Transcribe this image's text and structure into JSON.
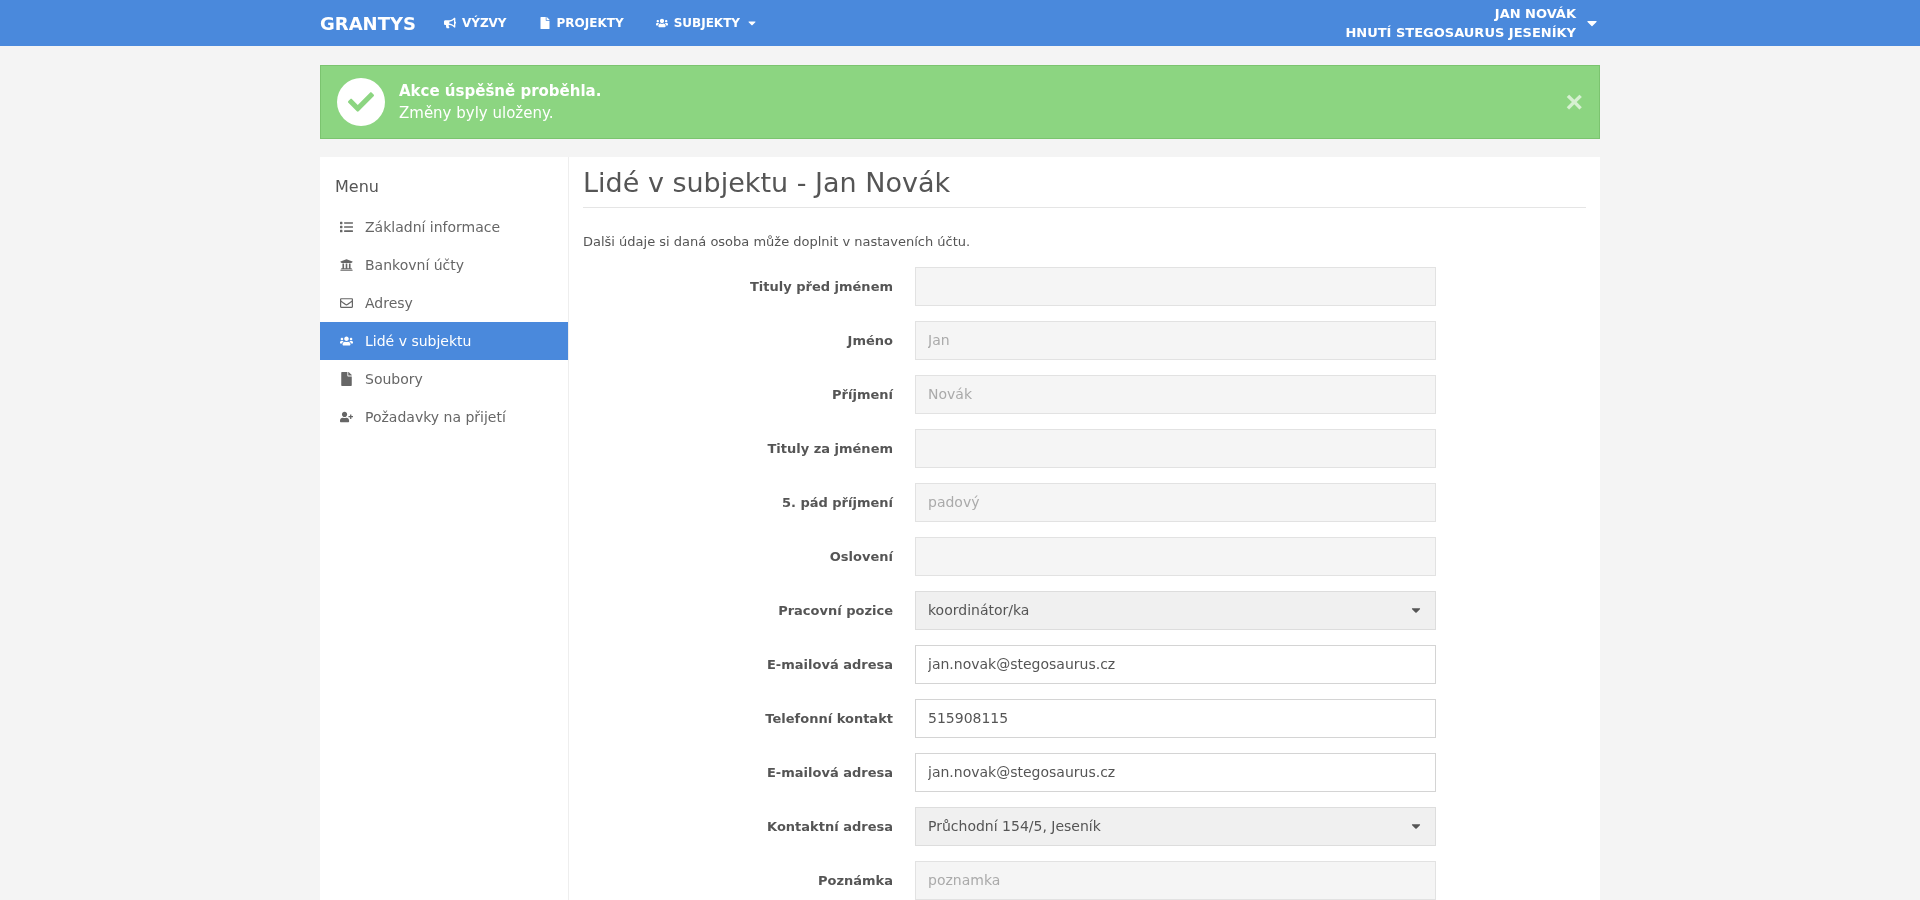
{
  "navbar": {
    "brand": "GRANTYS",
    "items": [
      {
        "label": "VÝZVY",
        "dropdown": false
      },
      {
        "label": "PROJEKTY",
        "dropdown": false
      },
      {
        "label": "SUBJEKTY",
        "dropdown": true
      }
    ],
    "user": {
      "name": "JAN NOVÁK",
      "organization": "HNUTÍ STEGOSAURUS JESENÍKY"
    }
  },
  "alert": {
    "title": "Akce úspěšně proběhla.",
    "message": "Změny byly uloženy.",
    "close": "×"
  },
  "sidebar": {
    "title": "Menu",
    "items": [
      {
        "label": "Základní informace",
        "selected": false
      },
      {
        "label": "Bankovní účty",
        "selected": false
      },
      {
        "label": "Adresy",
        "selected": false
      },
      {
        "label": "Lidé v subjektu",
        "selected": true
      },
      {
        "label": "Soubory",
        "selected": false
      },
      {
        "label": "Požadavky na přijetí",
        "selected": false
      }
    ]
  },
  "main": {
    "title": "Lidé v subjektu - Jan Novák",
    "help": "Dalši údaje si daná osoba může doplnit v nastaveních účtu.",
    "fields": [
      {
        "label": "Tituly před jménem",
        "kind": "input",
        "readonly": true
      },
      {
        "label": "Jméno",
        "kind": "input",
        "readonly": true,
        "placeholder": "Jan"
      },
      {
        "label": "Příjmení",
        "kind": "input",
        "readonly": true,
        "placeholder": "Novák"
      },
      {
        "label": "Tituly za jménem",
        "kind": "input",
        "readonly": true
      },
      {
        "label": "5. pád příjmení",
        "kind": "input",
        "readonly": true,
        "placeholder": "padový"
      },
      {
        "label": "Oslovení",
        "kind": "input",
        "readonly": true
      },
      {
        "label": "Pracovní pozice",
        "kind": "select",
        "value": "koordinátor/ka"
      },
      {
        "label": "E-mailová adresa",
        "kind": "input",
        "readonly": false,
        "value": "jan.novak@stegosaurus.cz"
      },
      {
        "label": "Telefonní kontakt",
        "kind": "input",
        "readonly": false,
        "value": "515908115"
      },
      {
        "label": "E-mailová adresa",
        "kind": "input",
        "readonly": false,
        "value": "jan.novak@stegosaurus.cz"
      },
      {
        "label": "Kontaktní adresa",
        "kind": "select",
        "value": "Průchodní 154/5, Jeseník"
      },
      {
        "label": "Poznámka",
        "kind": "input",
        "readonly": true,
        "placeholder": "poznamka"
      }
    ]
  }
}
